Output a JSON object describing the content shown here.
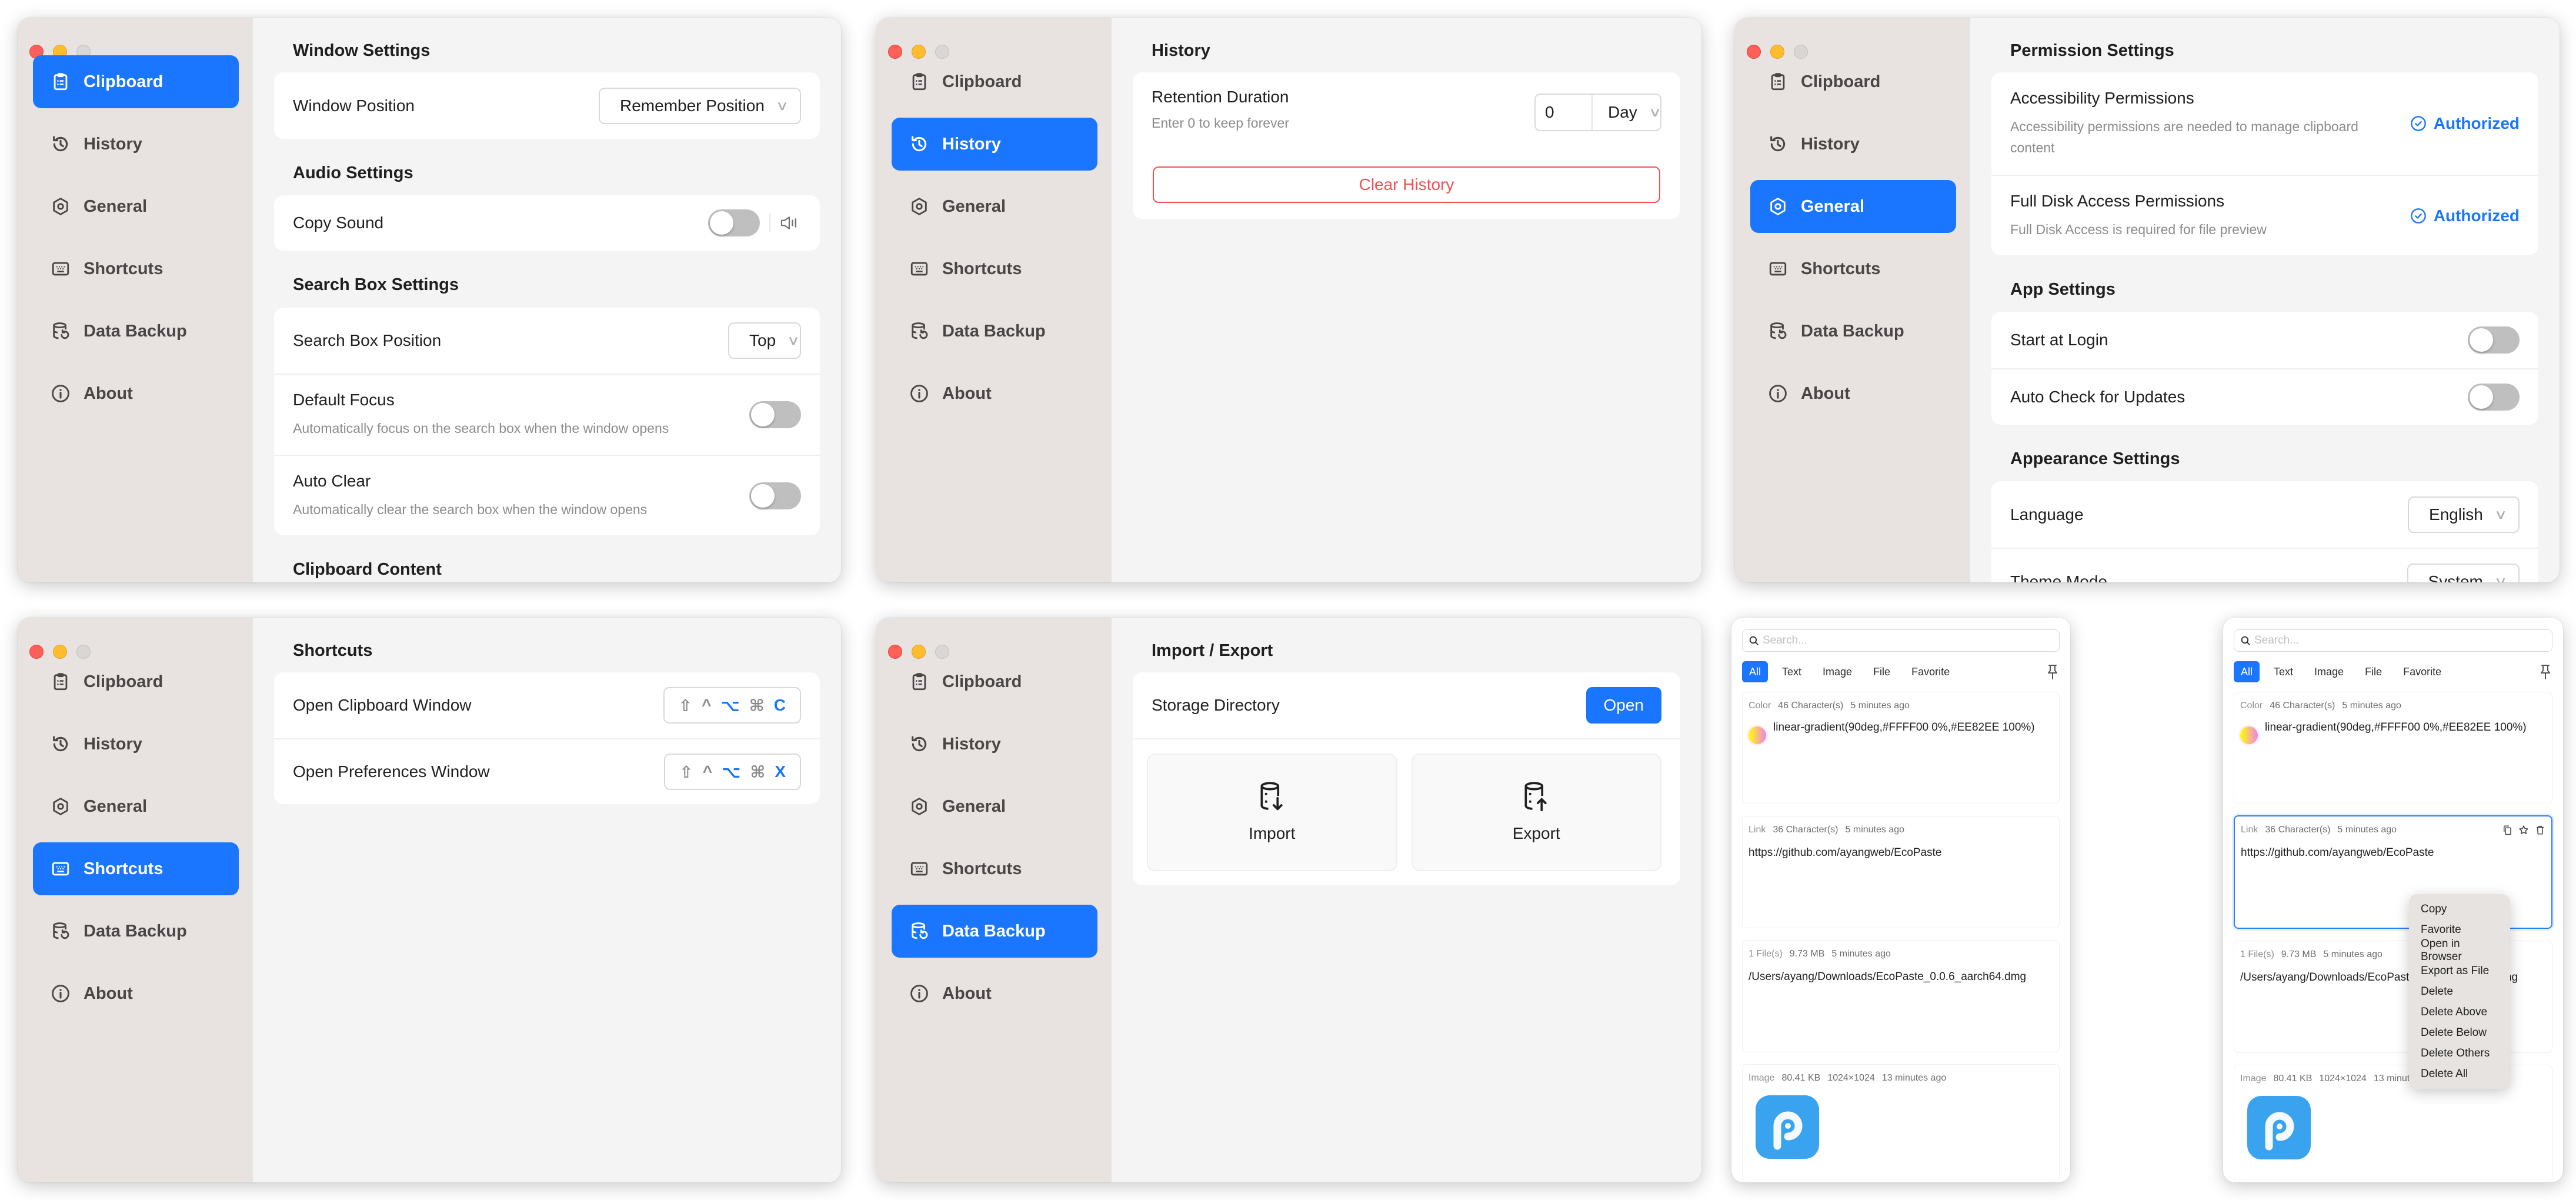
{
  "sidebar": {
    "items": [
      {
        "label": "Clipboard",
        "icon": "clipboard-icon"
      },
      {
        "label": "History",
        "icon": "history-icon"
      },
      {
        "label": "General",
        "icon": "general-icon"
      },
      {
        "label": "Shortcuts",
        "icon": "keyboard-icon"
      },
      {
        "label": "Data Backup",
        "icon": "database-backup-icon"
      },
      {
        "label": "About",
        "icon": "info-icon"
      }
    ]
  },
  "clipboard_settings": {
    "active_nav": "Clipboard",
    "window_settings": {
      "title": "Window Settings",
      "window_position_label": "Window Position",
      "window_position_value": "Remember Position"
    },
    "audio_settings": {
      "title": "Audio Settings",
      "copy_sound_label": "Copy Sound",
      "copy_sound_enabled": false
    },
    "search_box_settings": {
      "title": "Search Box Settings",
      "position_label": "Search Box Position",
      "position_value": "Top",
      "default_focus_label": "Default Focus",
      "default_focus_desc": "Automatically focus on the search box when the window opens",
      "default_focus_enabled": false,
      "auto_clear_label": "Auto Clear",
      "auto_clear_desc": "Automatically clear the search box when the window opens",
      "auto_clear_enabled": false
    },
    "clipboard_content": {
      "title": "Clipboard Content"
    }
  },
  "history_settings": {
    "active_nav": "History",
    "title": "History",
    "retention_label": "Retention Duration",
    "retention_desc": "Enter 0 to keep forever",
    "retention_value": "0",
    "retention_unit": "Day",
    "clear_button": "Clear History"
  },
  "general_settings": {
    "active_nav": "General",
    "permission_title": "Permission Settings",
    "accessibility_label": "Accessibility Permissions",
    "accessibility_desc": "Accessibility permissions are needed to manage clipboard content",
    "accessibility_status": "Authorized",
    "full_disk_label": "Full Disk Access Permissions",
    "full_disk_desc": "Full Disk Access is required for file preview",
    "full_disk_status": "Authorized",
    "app_title": "App Settings",
    "start_login_label": "Start at Login",
    "start_login_enabled": false,
    "auto_update_label": "Auto Check for Updates",
    "auto_update_enabled": false,
    "appearance_title": "Appearance Settings",
    "language_label": "Language",
    "language_value": "English",
    "theme_label": "Theme Mode",
    "theme_value": "System"
  },
  "shortcuts_settings": {
    "active_nav": "Shortcuts",
    "title": "Shortcuts",
    "items": [
      {
        "label": "Open Clipboard Window",
        "keys": [
          "⇧",
          "^",
          "⌥",
          "⌘",
          "C"
        ]
      },
      {
        "label": "Open Preferences Window",
        "keys": [
          "⇧",
          "^",
          "⌥",
          "⌘",
          "X"
        ]
      }
    ]
  },
  "backup_settings": {
    "active_nav": "Data Backup",
    "title": "Import / Export",
    "storage_label": "Storage Directory",
    "open_button": "Open",
    "import_label": "Import",
    "export_label": "Export"
  },
  "clipboard_window": {
    "search_placeholder": "Search...",
    "tabs": [
      "All",
      "Text",
      "Image",
      "File",
      "Favorite"
    ],
    "active_tab": "All",
    "items": [
      {
        "meta": [
          "Color",
          "46 Character(s)",
          "5 minutes ago"
        ],
        "content": "linear-gradient(90deg,#FFFF00 0%,#EE82EE 100%)"
      },
      {
        "meta": [
          "Link",
          "36 Character(s)",
          "5 minutes ago"
        ],
        "content": "https://github.com/ayangweb/EcoPaste"
      },
      {
        "meta": [
          "1 File(s)",
          "9.73 MB",
          "5 minutes ago"
        ],
        "content": "/Users/ayang/Downloads/EcoPaste_0.0.6_aarch64.dmg"
      },
      {
        "meta": [
          "Image",
          "80.41 KB",
          "1024×1024",
          "13 minutes ago"
        ],
        "content": ""
      }
    ],
    "context_menu": [
      "Copy",
      "Favorite",
      "Open in Browser",
      "Export as File",
      "Delete",
      "Delete Above",
      "Delete Below",
      "Delete Others",
      "Delete All"
    ]
  },
  "colors": {
    "accent": "#1a75ff",
    "danger": "#f15151",
    "sidebar_bg": "#e8e3e1",
    "content_bg": "#f4f4f4"
  }
}
